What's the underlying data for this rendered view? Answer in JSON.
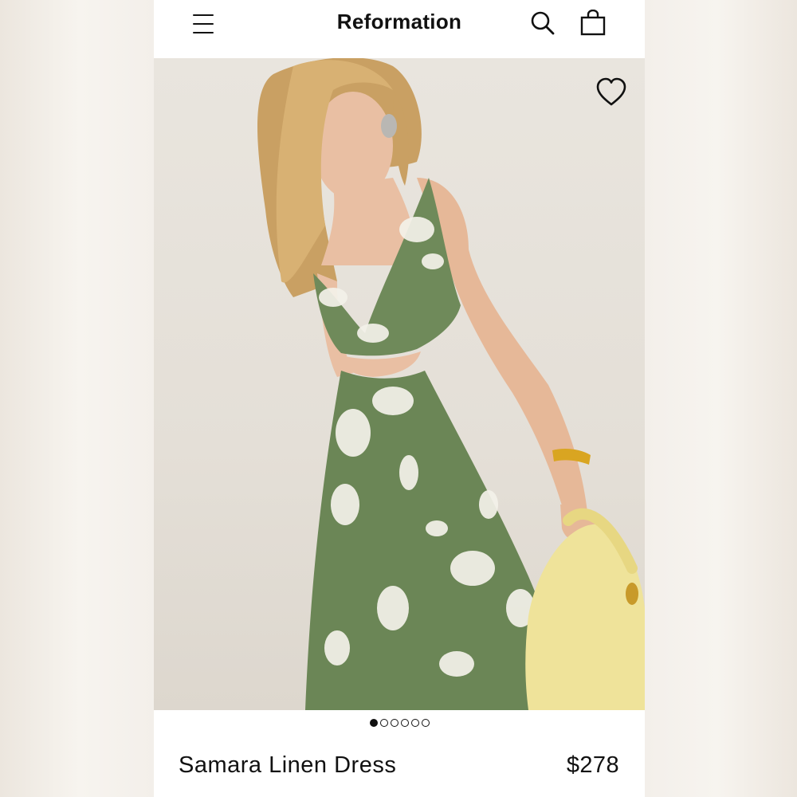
{
  "header": {
    "brand": "Reformation",
    "icons": [
      "menu-icon",
      "search-icon",
      "bag-icon"
    ]
  },
  "hero": {
    "image_alt": "Model wearing a green floral linen midi dress with cutouts, holding a yellow bag",
    "favorite_icon": "heart-icon",
    "carousel": {
      "total": 6,
      "active_index": 0
    }
  },
  "product": {
    "name": "Samara Linen Dress",
    "price": "$278"
  },
  "colors": {
    "text": "#111111",
    "dress": "#6f8a5a",
    "background_photo": "#e6e1da",
    "bag": "#f0e49a"
  }
}
